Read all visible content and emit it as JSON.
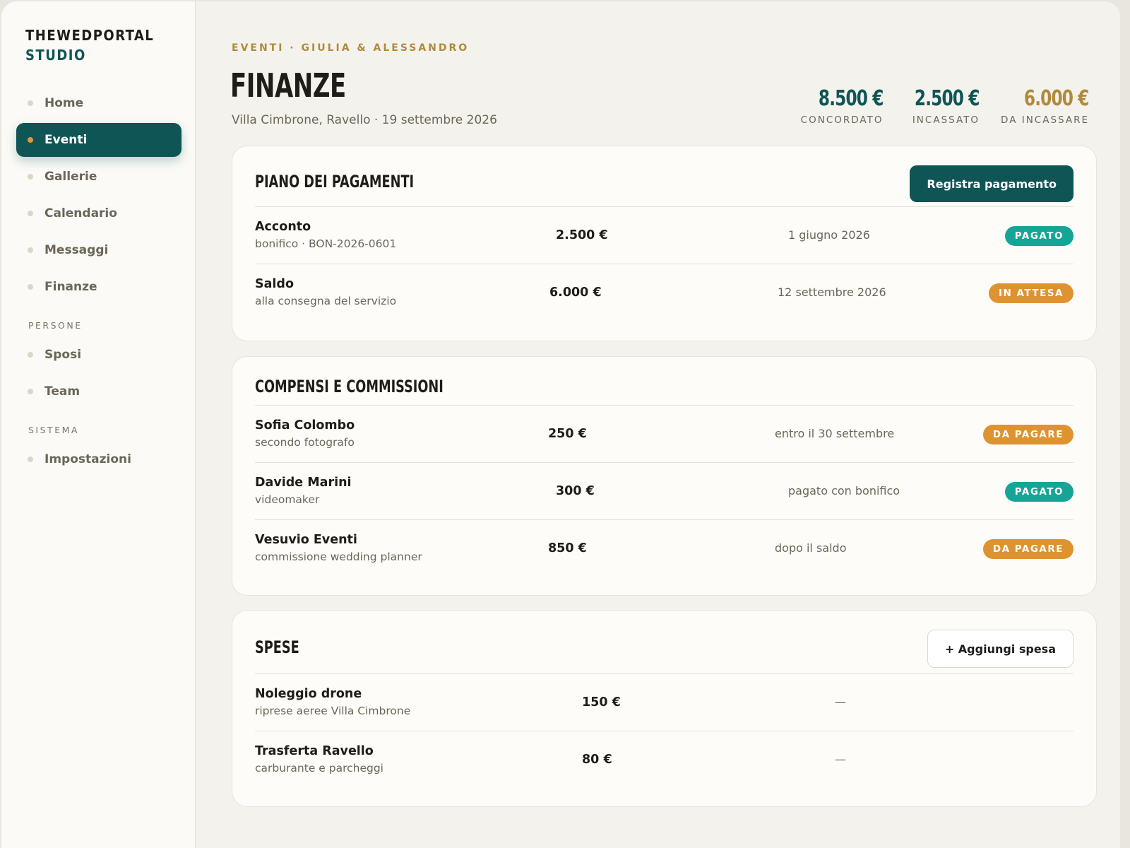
{
  "brand": {
    "line1": "THEWEDPORTAL",
    "line2": "STUDIO"
  },
  "nav": {
    "main": [
      {
        "label": "Home",
        "active": false
      },
      {
        "label": "Eventi",
        "active": true
      },
      {
        "label": "Gallerie",
        "active": false
      },
      {
        "label": "Calendario",
        "active": false
      },
      {
        "label": "Messaggi",
        "active": false
      },
      {
        "label": "Finanze",
        "active": false
      }
    ],
    "section_people": "PERSONE",
    "people": [
      {
        "label": "Sposi"
      },
      {
        "label": "Team"
      }
    ],
    "section_system": "SISTEMA",
    "system": [
      {
        "label": "Impostazioni"
      }
    ]
  },
  "header": {
    "breadcrumb": "EVENTI · GIULIA & ALESSANDRO",
    "title": "FINANZE",
    "subtitle": "Villa Cimbrone, Ravello · 19 settembre 2026"
  },
  "stats": [
    {
      "value": "8.500 €",
      "label": "CONCORDATO",
      "color": "#0f5556"
    },
    {
      "value": "2.500 €",
      "label": "INCASSATO",
      "color": "#0f5556"
    },
    {
      "value": "6.000 €",
      "label": "DA INCASSARE",
      "color": "#b08a3b"
    }
  ],
  "payments": {
    "title": "PIANO DEI PAGAMENTI",
    "button": "Registra pagamento",
    "rows": [
      {
        "name": "Acconto",
        "desc": "bonifico · BON-2026-0601",
        "amount": "2.500 €",
        "when": "1 giugno 2026",
        "status": "PAGATO",
        "status_kind": "paid"
      },
      {
        "name": "Saldo",
        "desc": "alla consegna del servizio",
        "amount": "6.000 €",
        "when": "12 settembre 2026",
        "status": "IN ATTESA",
        "status_kind": "pending"
      }
    ]
  },
  "fees": {
    "title": "COMPENSI E COMMISSIONI",
    "rows": [
      {
        "name": "Sofia Colombo",
        "desc": "secondo fotografo",
        "amount": "250 €",
        "when": "entro il 30 settembre",
        "status": "DA PAGARE",
        "status_kind": "pending"
      },
      {
        "name": "Davide Marini",
        "desc": "videomaker",
        "amount": "300 €",
        "when": "pagato con bonifico",
        "status": "PAGATO",
        "status_kind": "paid"
      },
      {
        "name": "Vesuvio Eventi",
        "desc": "commissione wedding planner",
        "amount": "850 €",
        "when": "dopo il saldo",
        "status": "DA PAGARE",
        "status_kind": "pending"
      }
    ]
  },
  "expenses": {
    "title": "SPESE",
    "button": "+ Aggiungi spesa",
    "rows": [
      {
        "name": "Noleggio drone",
        "desc": "riprese aeree Villa Cimbrone",
        "amount": "150 €",
        "when": "—"
      },
      {
        "name": "Trasferta Ravello",
        "desc": "carburante e parcheggi",
        "amount": "80 €",
        "when": "—"
      }
    ]
  }
}
